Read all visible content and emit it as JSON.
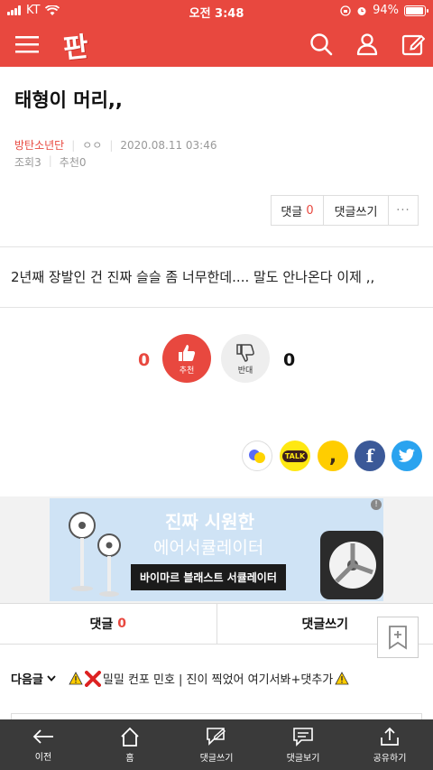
{
  "status": {
    "carrier": "KT",
    "time": "오전 3:48",
    "battery": "94%",
    "battery_level": 0.94
  },
  "header": {
    "logo": "판",
    "icons": [
      "menu-icon",
      "search-icon",
      "user-icon",
      "edit-icon"
    ]
  },
  "post": {
    "title": "태형이 머리,,",
    "author": "방탄소년단",
    "nickname": "ㅇㅇ",
    "date": "2020.08.11 03:46",
    "views_label": "조회",
    "views": "3",
    "recommend_label": "추천",
    "recommend": "0",
    "body": "2년째 장발인 건 진짜 슬슬 좀 너무한데.... 말도 안나온다 이제 ,,"
  },
  "actions": {
    "comment_label": "댓글",
    "comment_count": "0",
    "write_comment": "댓글쓰기",
    "more": "···"
  },
  "votes": {
    "up_count": "0",
    "up_label": "추천",
    "down_count": "0",
    "down_label": "반대"
  },
  "share": {
    "talk": "TALK",
    "story": ",",
    "facebook": "f",
    "icons": [
      "bubble-share-icon",
      "kakaotalk-icon",
      "kakaostory-icon",
      "facebook-icon",
      "twitter-icon"
    ]
  },
  "ad": {
    "headline": "진짜 시원한",
    "subline": "에어서큘레이터",
    "tag": "바이마르 블래스트 서큘레이터",
    "badge": "!"
  },
  "comment_bar": {
    "comment_label": "댓글",
    "comment_count": "0",
    "write_comment": "댓글쓰기"
  },
  "next": {
    "label": "다음글",
    "title": "밀밀 컨포 민호 | 진이 찍었어 여기서봐+댓추가"
  },
  "bottom_nav": {
    "items": [
      {
        "label": "이전",
        "icon": "back-arrow-icon"
      },
      {
        "label": "홈",
        "icon": "home-icon"
      },
      {
        "label": "댓글쓰기",
        "icon": "write-comment-icon"
      },
      {
        "label": "댓글보기",
        "icon": "view-comments-icon"
      },
      {
        "label": "공유하기",
        "icon": "share-icon"
      }
    ]
  },
  "colors": {
    "accent": "#e8483f",
    "nav_bg": "#3a3a3a"
  }
}
